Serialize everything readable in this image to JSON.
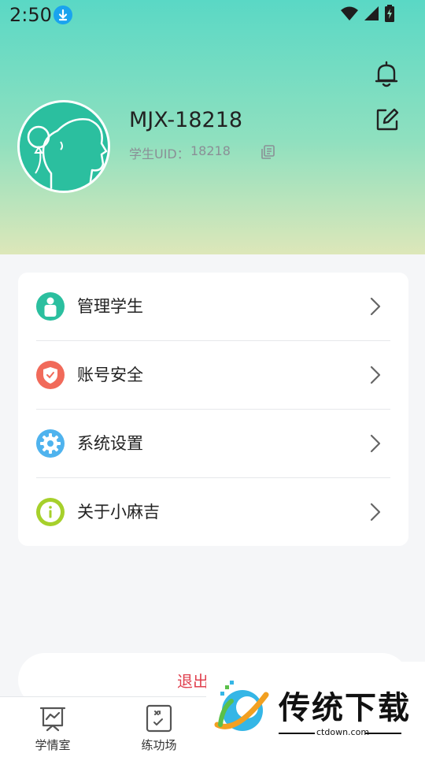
{
  "status_bar": {
    "time": "2:50",
    "icons": [
      "download-badge-icon",
      "wifi-icon",
      "signal-icon",
      "battery-icon"
    ]
  },
  "header": {
    "icons": [
      "bell-icon",
      "edit-icon"
    ],
    "profile": {
      "username": "MJX-18218",
      "uid_label": "学生UID：",
      "uid_value": "18218",
      "avatar_icon": "student-avatar-icon",
      "copy_icon": "copy-icon"
    }
  },
  "menu": {
    "items": [
      {
        "label": "管理学生",
        "icon": "student-manage-icon",
        "color": "#2bbf9f"
      },
      {
        "label": "账号安全",
        "icon": "shield-icon",
        "color": "#f16a5a"
      },
      {
        "label": "系统设置",
        "icon": "gear-icon",
        "color": "#4fb3ee"
      },
      {
        "label": "关于小麻吉",
        "icon": "info-icon",
        "color": "#a6d02b"
      }
    ]
  },
  "logout": {
    "label": "退出"
  },
  "bottom_nav": {
    "items": [
      {
        "label": "学情室",
        "icon": "chart-board-icon"
      },
      {
        "label": "练功场",
        "icon": "practice-card-icon"
      }
    ]
  },
  "watermark": {
    "title": "传统下载",
    "domain": "ctdown.com"
  },
  "colors": {
    "header_top": "#5ad8c5",
    "header_bottom": "#dde7b9",
    "logout_text": "#e0414f",
    "background": "#f5f6f8"
  }
}
